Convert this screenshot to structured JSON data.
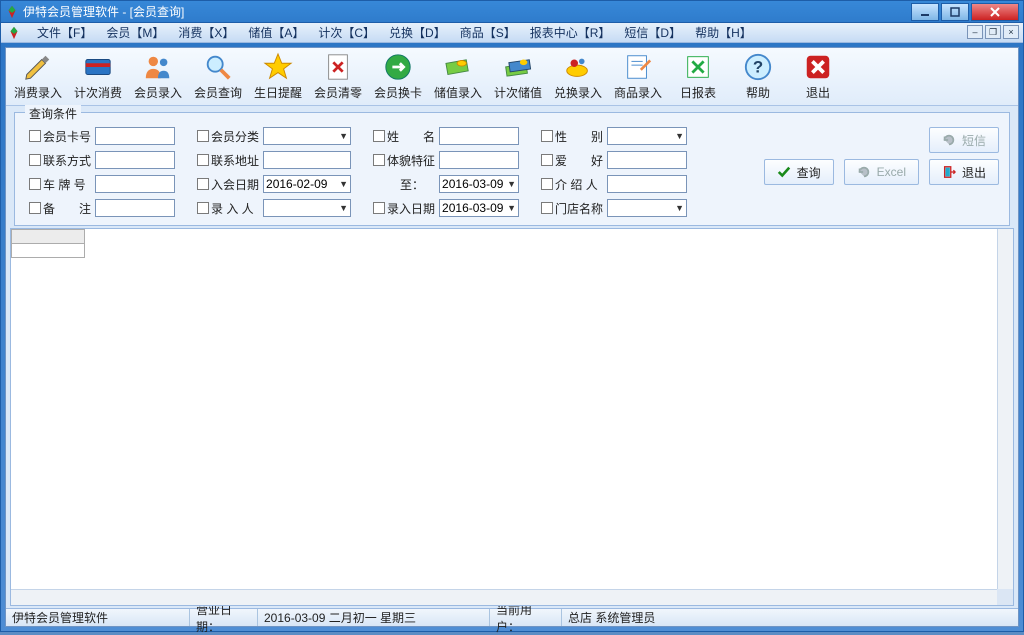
{
  "window": {
    "title": "伊特会员管理软件 - [会员查询]"
  },
  "menu": {
    "items": [
      "文件【F】",
      "会员【M】",
      "消费【X】",
      "储值【A】",
      "计次【C】",
      "兑换【D】",
      "商品【S】",
      "报表中心【R】",
      "短信【D】",
      "帮助【H】"
    ]
  },
  "toolbar": {
    "items": [
      {
        "label": "消费录入",
        "icon": "pen"
      },
      {
        "label": "计次消费",
        "icon": "card"
      },
      {
        "label": "会员录入",
        "icon": "people"
      },
      {
        "label": "会员查询",
        "icon": "search"
      },
      {
        "label": "生日提醒",
        "icon": "star"
      },
      {
        "label": "会员清零",
        "icon": "doc-x"
      },
      {
        "label": "会员换卡",
        "icon": "swap"
      },
      {
        "label": "储值录入",
        "icon": "cash"
      },
      {
        "label": "计次储值",
        "icon": "cash2"
      },
      {
        "label": "兑换录入",
        "icon": "gift"
      },
      {
        "label": "商品录入",
        "icon": "edit"
      },
      {
        "label": "日报表",
        "icon": "excel"
      },
      {
        "label": "帮助",
        "icon": "help"
      },
      {
        "label": "退出",
        "icon": "close"
      }
    ]
  },
  "query": {
    "panel_title": "查询条件",
    "fields": {
      "card_no": "会员卡号",
      "category": "会员分类",
      "name": "姓　　名",
      "gender": "性　　别",
      "contact": "联系方式",
      "address": "联系地址",
      "appearance": "体貌特征",
      "hobby": "爱　　好",
      "plate": "车 牌 号",
      "join_date": "入会日期",
      "join_from": "2016-02-09",
      "join_to_lbl": "至：",
      "join_to": "2016-03-09",
      "referrer": "介 绍 人",
      "remark": "备　　注",
      "operator": "录 入 人",
      "entry_date_lbl": "录入日期",
      "entry_date": "2016-03-09",
      "store": "门店名称"
    },
    "buttons": {
      "sms": "短信",
      "query": "查询",
      "excel": "Excel",
      "exit": "退出"
    }
  },
  "status": {
    "app": "伊特会员管理软件",
    "biz_date_lbl": "营业日期：",
    "biz_date": "2016-03-09  二月初一  星期三",
    "user_lbl": "当前用户：",
    "user": "总店 系统管理员"
  }
}
